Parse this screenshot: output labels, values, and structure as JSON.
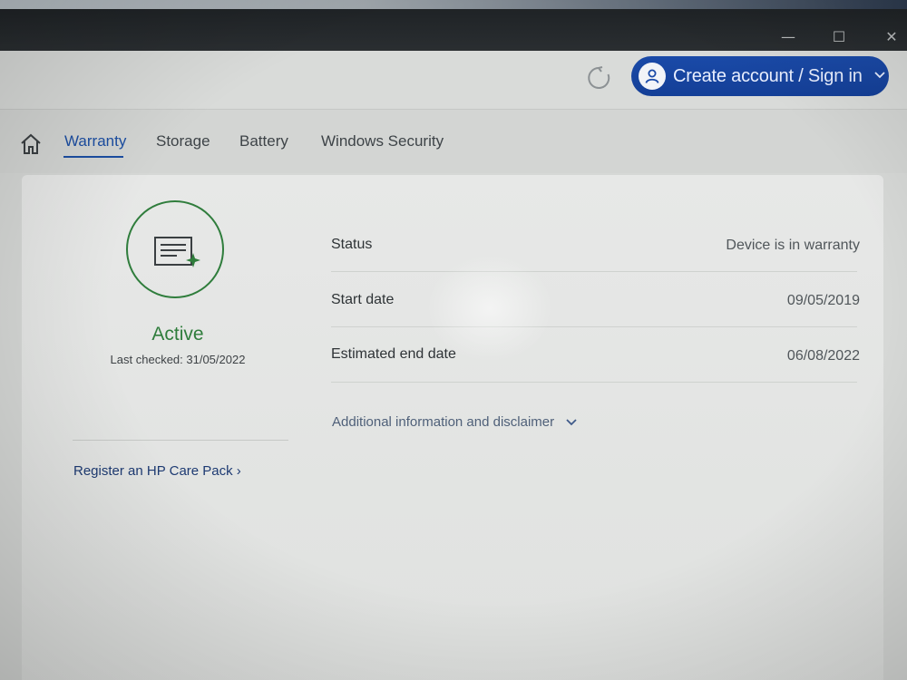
{
  "window": {
    "minimize_glyph": "—",
    "maximize_glyph": "☐",
    "close_glyph": "✕"
  },
  "header": {
    "refresh_icon": "refresh-icon",
    "account_label": "Create account / Sign in",
    "account_icon": "user-icon",
    "accent_color": "#1a4aa8"
  },
  "tabs": {
    "home_icon": "home-icon",
    "items": [
      {
        "label": "Warranty",
        "active": true
      },
      {
        "label": "Storage",
        "active": false
      },
      {
        "label": "Battery",
        "active": false
      },
      {
        "label": "Windows Security",
        "active": false
      }
    ]
  },
  "warranty": {
    "status_icon": "warranty-document-icon",
    "state": "Active",
    "state_color": "#2f7d3c",
    "last_checked": "Last checked: 31/05/2022",
    "care_pack_link": "Register an HP Care Pack ›",
    "rows": [
      {
        "label": "Status",
        "value": "Device is in warranty"
      },
      {
        "label": "Start date",
        "value": "09/05/2019"
      },
      {
        "label": "Estimated end date",
        "value": "06/08/2022"
      }
    ],
    "disclaimer": "Additional information and disclaimer"
  }
}
